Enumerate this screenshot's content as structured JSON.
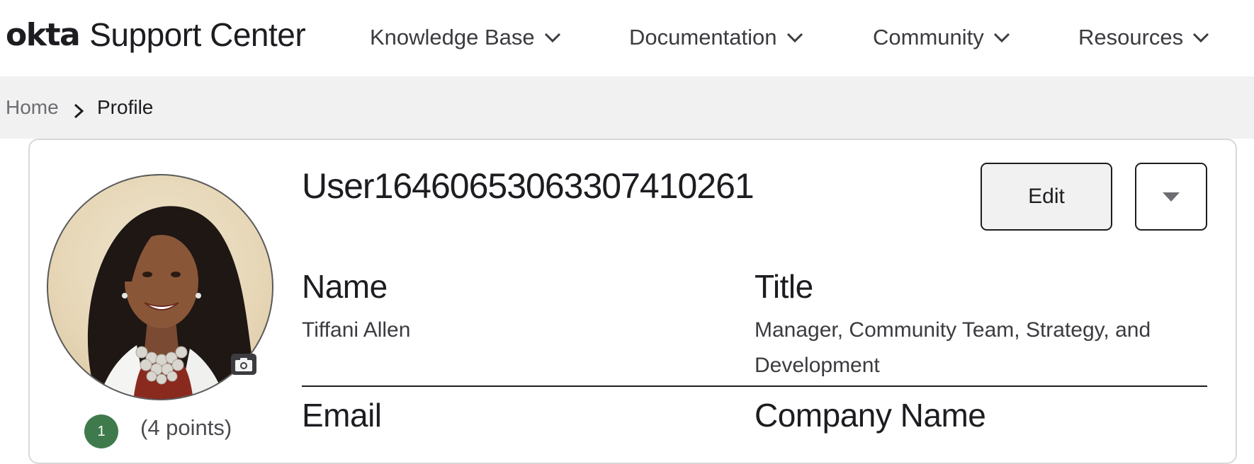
{
  "header": {
    "logo_text": "okta",
    "title": "Support Center",
    "nav": [
      {
        "label": "Knowledge Base",
        "icon": "chevron-down-icon"
      },
      {
        "label": "Documentation",
        "icon": "chevron-down-icon"
      },
      {
        "label": "Community",
        "icon": "chevron-down-icon"
      },
      {
        "label": "Resources",
        "icon": "chevron-down-icon"
      }
    ]
  },
  "breadcrumb": {
    "items": [
      "Home",
      "Profile"
    ],
    "separator_icon": "chevron-right-icon"
  },
  "profile": {
    "username": "User16460653063307410261",
    "edit_label": "Edit",
    "more_icon": "caret-down-icon",
    "level": "1",
    "points_text": "(4 points)",
    "fields": {
      "name_label": "Name",
      "name_value": "Tiffani Allen",
      "title_label": "Title",
      "title_value": "Manager, Community Team, Strategy, and Development",
      "email_label": "Email",
      "company_label": "Company Name"
    }
  },
  "colors": {
    "header_bg": "#ffffff",
    "breadcrumb_bg": "#f1f1f1",
    "text": "#1d1d21",
    "level_badge": "#3f7a4d",
    "edit_button_bg": "#f1f1f1"
  }
}
